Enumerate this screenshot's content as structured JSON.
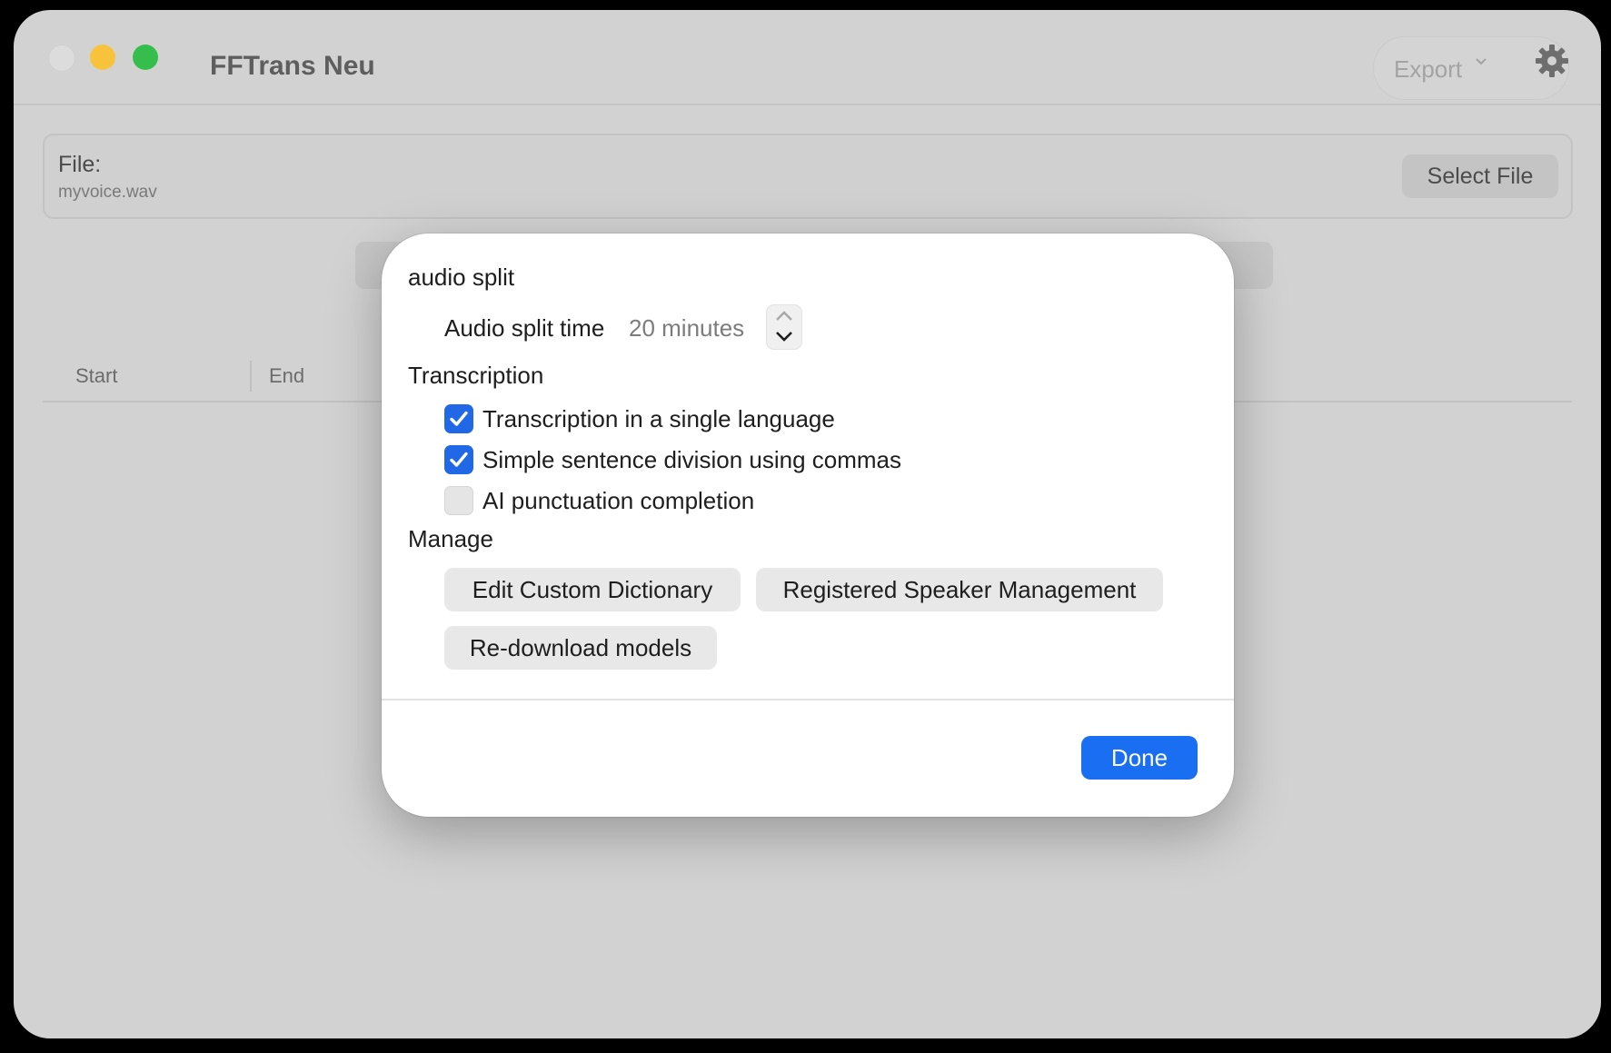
{
  "window": {
    "title": "FFTrans Neu",
    "export_label": "Export",
    "icons": [
      "close-icon",
      "minimize-icon",
      "zoom-icon",
      "chevron-down-icon",
      "gear-icon"
    ]
  },
  "file": {
    "label": "File:",
    "name": "myvoice.wav",
    "select_button": "Select File"
  },
  "table": {
    "columns": [
      "Start",
      "End"
    ]
  },
  "dialog": {
    "audio_split": {
      "section_title": "audio split",
      "time_label": "Audio split time",
      "time_value": "20 minutes"
    },
    "transcription": {
      "section_title": "Transcription",
      "options": [
        {
          "label": "Transcription in a single language",
          "checked": true
        },
        {
          "label": "Simple sentence division using commas",
          "checked": true
        },
        {
          "label": "AI punctuation completion",
          "checked": false
        }
      ]
    },
    "manage": {
      "section_title": "Manage",
      "buttons": [
        "Edit Custom Dictionary",
        "Registered Speaker Management",
        "Re-download models"
      ]
    },
    "done_label": "Done"
  },
  "colors": {
    "accent": "#1a6ef1",
    "checkbox_on": "#2168e6",
    "traffic_min": "#f7c33b",
    "traffic_max": "#35be4c"
  }
}
